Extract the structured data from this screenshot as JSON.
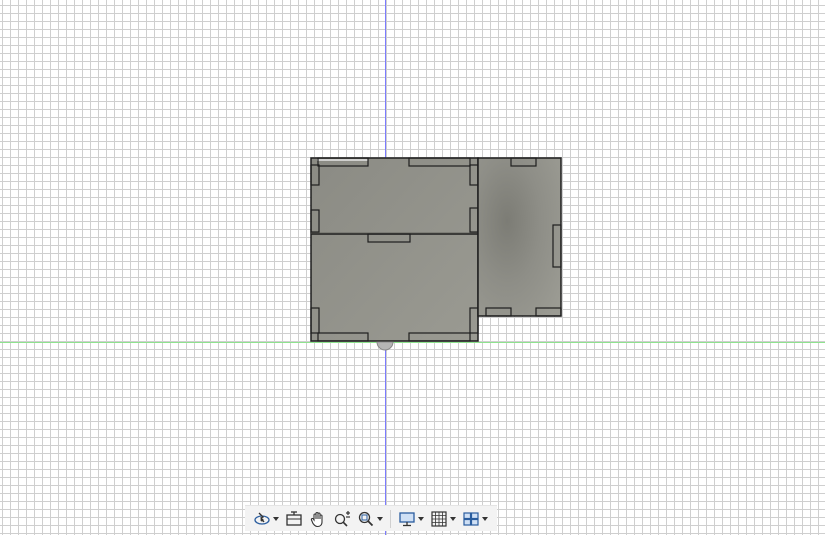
{
  "viewport": {
    "colors": {
      "background": "#ffffff",
      "grid": "#cfcfcf",
      "axis_vertical": "#7b7bff",
      "axis_horizontal": "#8ee28e",
      "body_fill": "#94948c",
      "body_outline": "#1e1e1e"
    }
  },
  "navigation_bar": {
    "tools": [
      {
        "name": "orbit-tool",
        "icon": "orbit-icon",
        "has_dropdown": true
      },
      {
        "name": "look-at-tool",
        "icon": "look-at-icon",
        "has_dropdown": false
      },
      {
        "name": "pan-tool",
        "icon": "hand-icon",
        "has_dropdown": false
      },
      {
        "name": "zoom-tool",
        "icon": "zoom-plus-minus-icon",
        "has_dropdown": false
      },
      {
        "name": "zoom-window-tool",
        "icon": "zoom-window-icon",
        "has_dropdown": true
      },
      {
        "name": "display-settings-tool",
        "icon": "monitor-icon",
        "has_dropdown": true
      },
      {
        "name": "grid-settings-tool",
        "icon": "grid-icon",
        "has_dropdown": true
      },
      {
        "name": "viewports-tool",
        "icon": "viewports-icon",
        "has_dropdown": true
      }
    ]
  }
}
